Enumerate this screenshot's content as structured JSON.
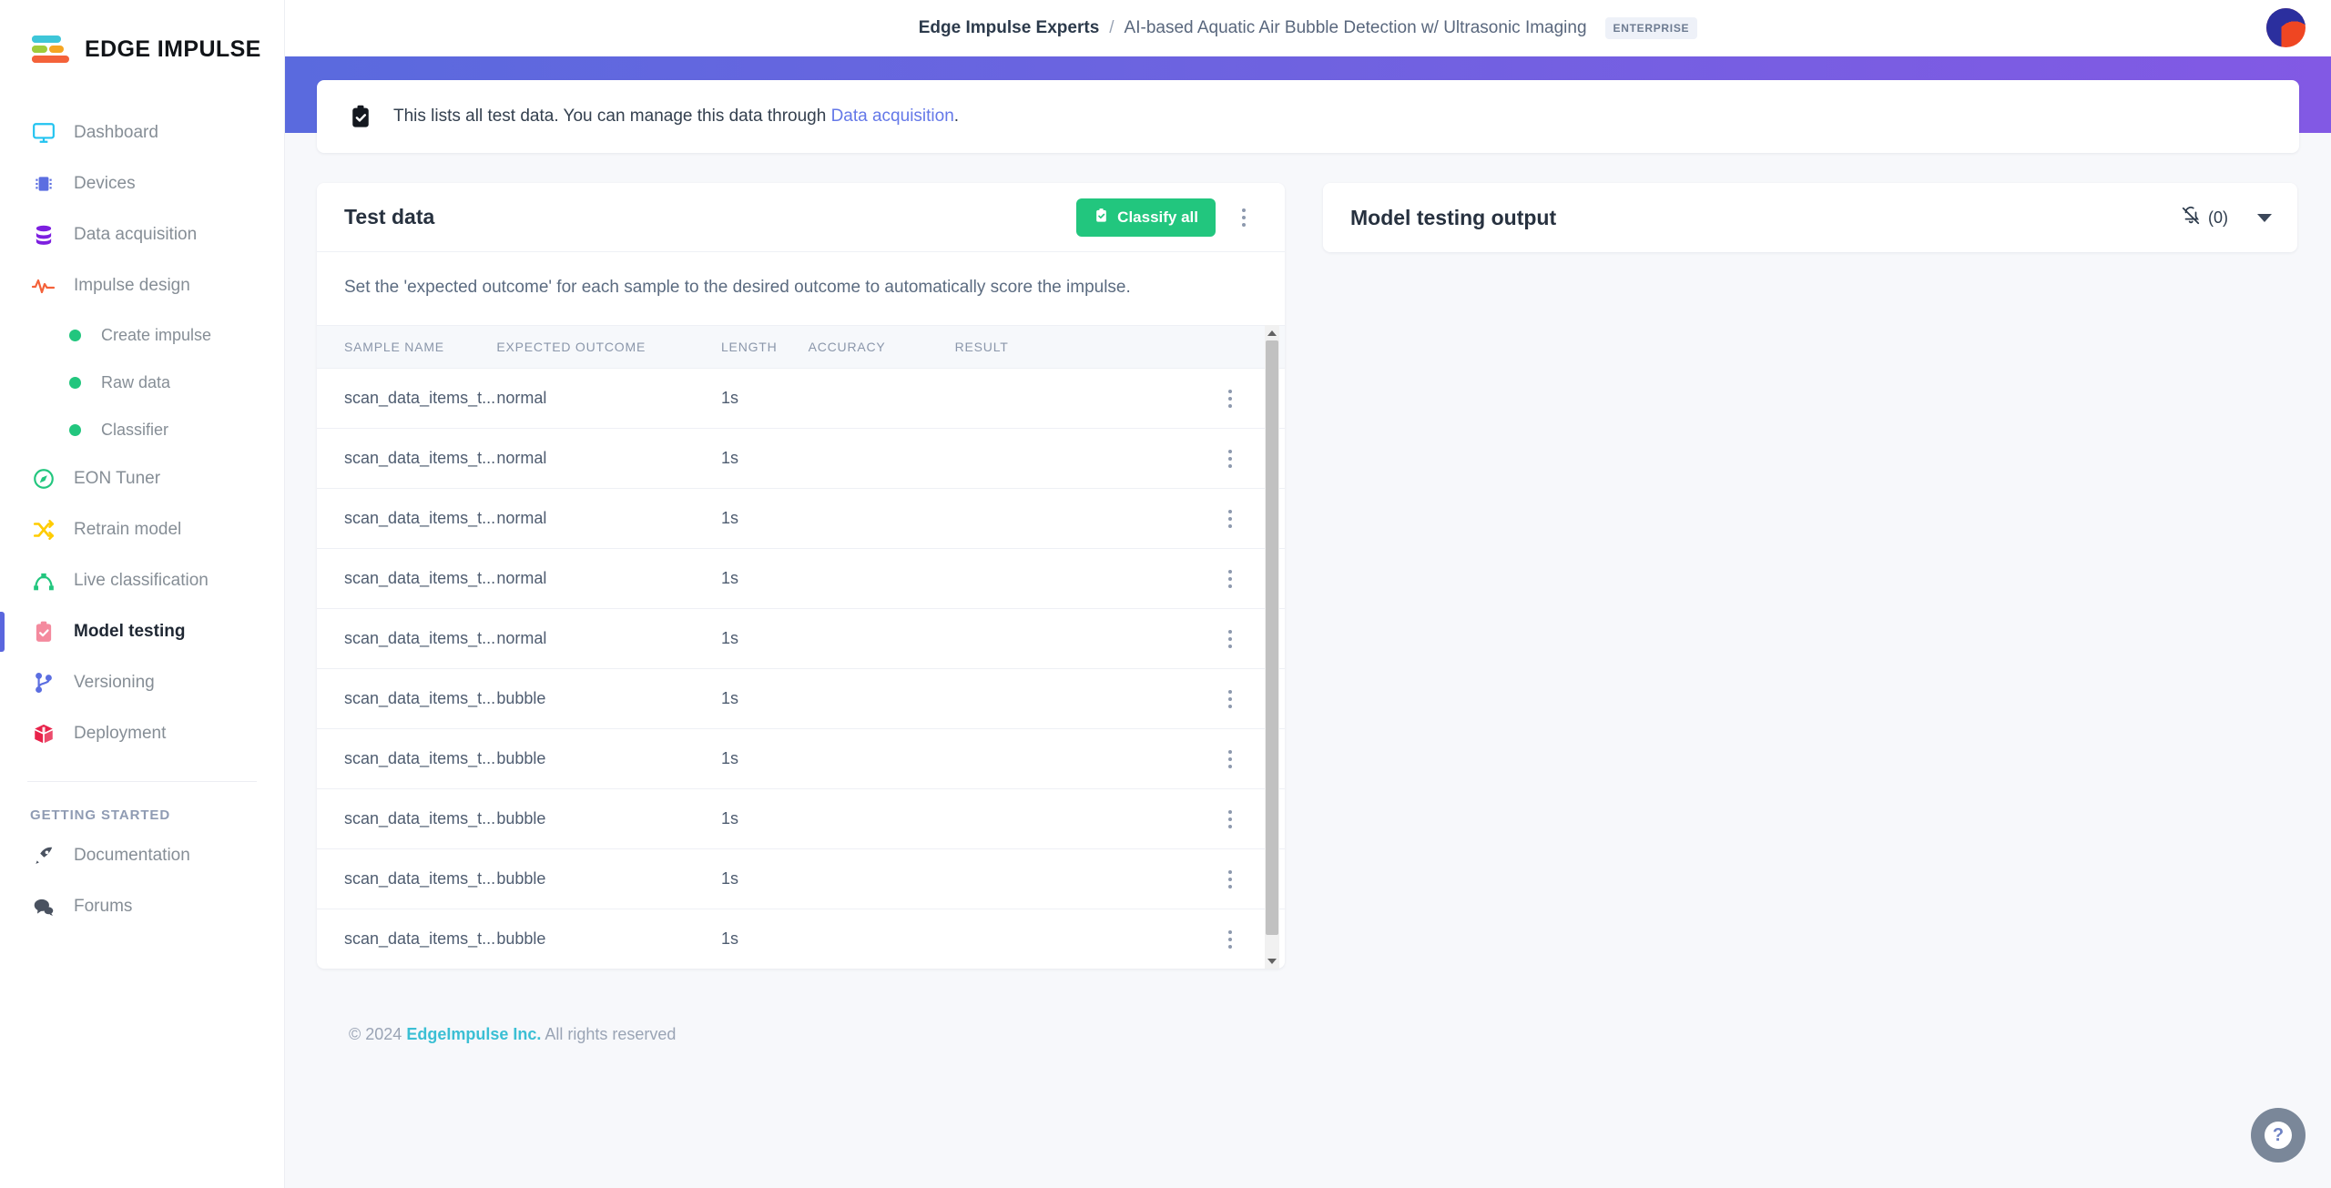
{
  "brand": {
    "logo_text": "EDGE IMPULSE",
    "colors": {
      "teal": "#3ec6d8",
      "green": "#9fcc3b",
      "orange": "#f5a623",
      "red": "#f4623a",
      "accent_blue": "#5a66de",
      "accent_green": "#22c67e"
    }
  },
  "header": {
    "org": "Edge Impulse Experts",
    "separator": "/",
    "project": "AI-based Aquatic Air Bubble Detection w/ Ultrasonic Imaging",
    "badge": "ENTERPRISE",
    "avatar_icon": "user-avatar"
  },
  "sidebar": {
    "items": [
      {
        "label": "Dashboard",
        "icon": "monitor-icon",
        "active": false
      },
      {
        "label": "Devices",
        "icon": "chip-icon",
        "active": false
      },
      {
        "label": "Data acquisition",
        "icon": "database-icon",
        "active": false
      },
      {
        "label": "Impulse design",
        "icon": "pulse-icon",
        "active": false
      }
    ],
    "subitems": [
      {
        "label": "Create impulse",
        "icon": "dot-icon"
      },
      {
        "label": "Raw data",
        "icon": "dot-icon"
      },
      {
        "label": "Classifier",
        "icon": "dot-icon"
      }
    ],
    "items2": [
      {
        "label": "EON Tuner",
        "icon": "compass-icon",
        "active": false
      },
      {
        "label": "Retrain model",
        "icon": "shuffle-icon",
        "active": false
      },
      {
        "label": "Live classification",
        "icon": "bezier-icon",
        "active": false
      },
      {
        "label": "Model testing",
        "icon": "clipboard-check-icon",
        "active": true
      },
      {
        "label": "Versioning",
        "icon": "git-branch-icon",
        "active": false
      },
      {
        "label": "Deployment",
        "icon": "box-icon",
        "active": false
      }
    ],
    "section_label": "GETTING STARTED",
    "items3": [
      {
        "label": "Documentation",
        "icon": "rocket-icon"
      },
      {
        "label": "Forums",
        "icon": "chat-icon"
      }
    ]
  },
  "banner": {
    "icon": "clipboard-check-icon",
    "text_before": "This lists all test data. You can manage this data through ",
    "link": "Data acquisition",
    "text_after": "."
  },
  "test_data": {
    "title": "Test data",
    "classify_button": "Classify all",
    "classify_icon": "clipboard-check-icon",
    "menu_icon": "kebab-menu-icon",
    "hint": "Set the 'expected outcome' for each sample to the desired outcome to automatically score the impulse.",
    "columns": [
      "SAMPLE NAME",
      "EXPECTED OUTCOME",
      "LENGTH",
      "ACCURACY",
      "RESULT"
    ],
    "rows": [
      {
        "name": "scan_data_items_t...",
        "expected": "normal",
        "length": "1s",
        "accuracy": "",
        "result": ""
      },
      {
        "name": "scan_data_items_t...",
        "expected": "normal",
        "length": "1s",
        "accuracy": "",
        "result": ""
      },
      {
        "name": "scan_data_items_t...",
        "expected": "normal",
        "length": "1s",
        "accuracy": "",
        "result": ""
      },
      {
        "name": "scan_data_items_t...",
        "expected": "normal",
        "length": "1s",
        "accuracy": "",
        "result": ""
      },
      {
        "name": "scan_data_items_t...",
        "expected": "normal",
        "length": "1s",
        "accuracy": "",
        "result": ""
      },
      {
        "name": "scan_data_items_t...",
        "expected": "bubble",
        "length": "1s",
        "accuracy": "",
        "result": ""
      },
      {
        "name": "scan_data_items_t...",
        "expected": "bubble",
        "length": "1s",
        "accuracy": "",
        "result": ""
      },
      {
        "name": "scan_data_items_t...",
        "expected": "bubble",
        "length": "1s",
        "accuracy": "",
        "result": ""
      },
      {
        "name": "scan_data_items_t...",
        "expected": "bubble",
        "length": "1s",
        "accuracy": "",
        "result": ""
      },
      {
        "name": "scan_data_items_t...",
        "expected": "bubble",
        "length": "1s",
        "accuracy": "",
        "result": ""
      }
    ]
  },
  "model_output": {
    "title": "Model testing output",
    "bell_icon": "bell-off-icon",
    "count": "(0)",
    "caret_icon": "chevron-down-icon"
  },
  "footer": {
    "copyright": "© 2024",
    "company": "EdgeImpulse Inc.",
    "rights": "All rights reserved"
  },
  "help": {
    "icon": "question-mark-icon",
    "label": "?"
  }
}
